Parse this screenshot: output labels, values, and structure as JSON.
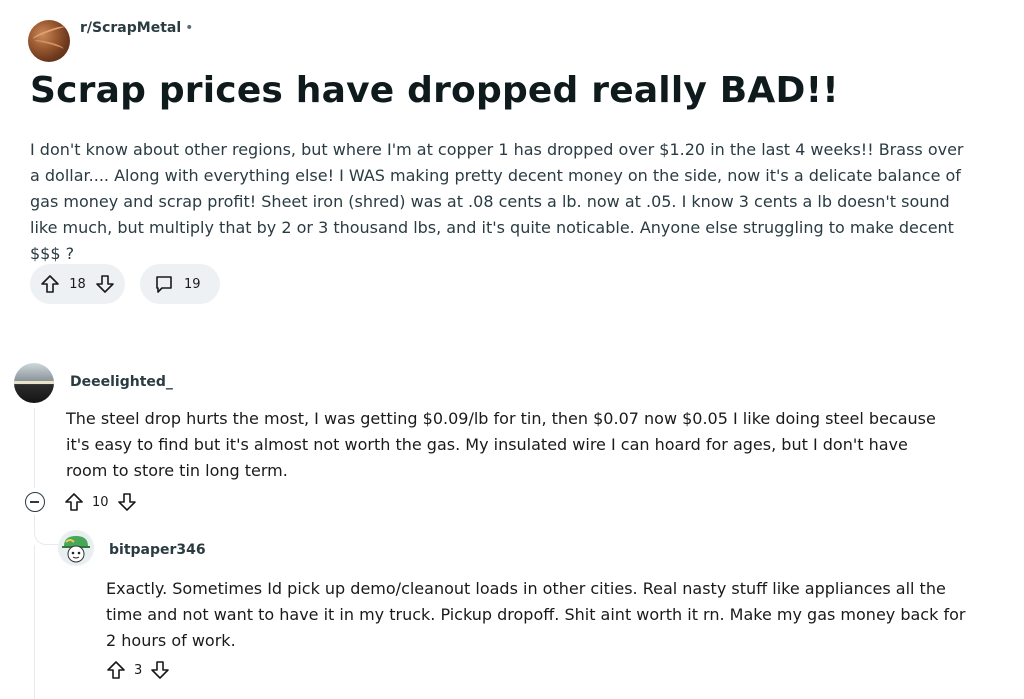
{
  "post": {
    "subreddit": "r/ScrapMetal",
    "separator": "•",
    "title": "Scrap prices have dropped really BAD!!",
    "body": "I don't know about other regions, but where I'm at copper 1 has dropped over $1.20 in the last 4 weeks!! Brass over a dollar.... Along with everything else! I WAS making pretty decent money on the side, now it's a delicate balance of gas money and scrap profit! Sheet iron (shred) was at .08 cents a lb. now at .05. I know 3 cents a lb doesn't sound like much, but multiply that by 2 or 3 thousand lbs, and it's quite noticable. Anyone else struggling to make decent $$$ ?",
    "upvotes": "18",
    "comments": "19"
  },
  "comments": [
    {
      "author": "Deeelighted_",
      "body": "The steel drop hurts the most, I was getting $0.09/lb for tin, then $0.07 now $0.05 I like doing steel because it's easy to find but it's almost not worth the gas. My insulated wire I can hoard for ages, but I don't have room to store tin long term.",
      "votes": "10"
    },
    {
      "author": "bitpaper346",
      "body": "Exactly. Sometimes Id pick up demo/cleanout loads in other cities. Real nasty stuff like appliances all the time and not want to have it in my truck. Pickup dropoff. Shit aint worth it rn. Make my gas money back for 2 hours of work.",
      "votes": "3"
    }
  ],
  "icons": {
    "upvote": "arrow-up-outline",
    "downvote": "arrow-down-outline",
    "comment": "speech-bubble-outline",
    "collapse": "circle-minus"
  }
}
